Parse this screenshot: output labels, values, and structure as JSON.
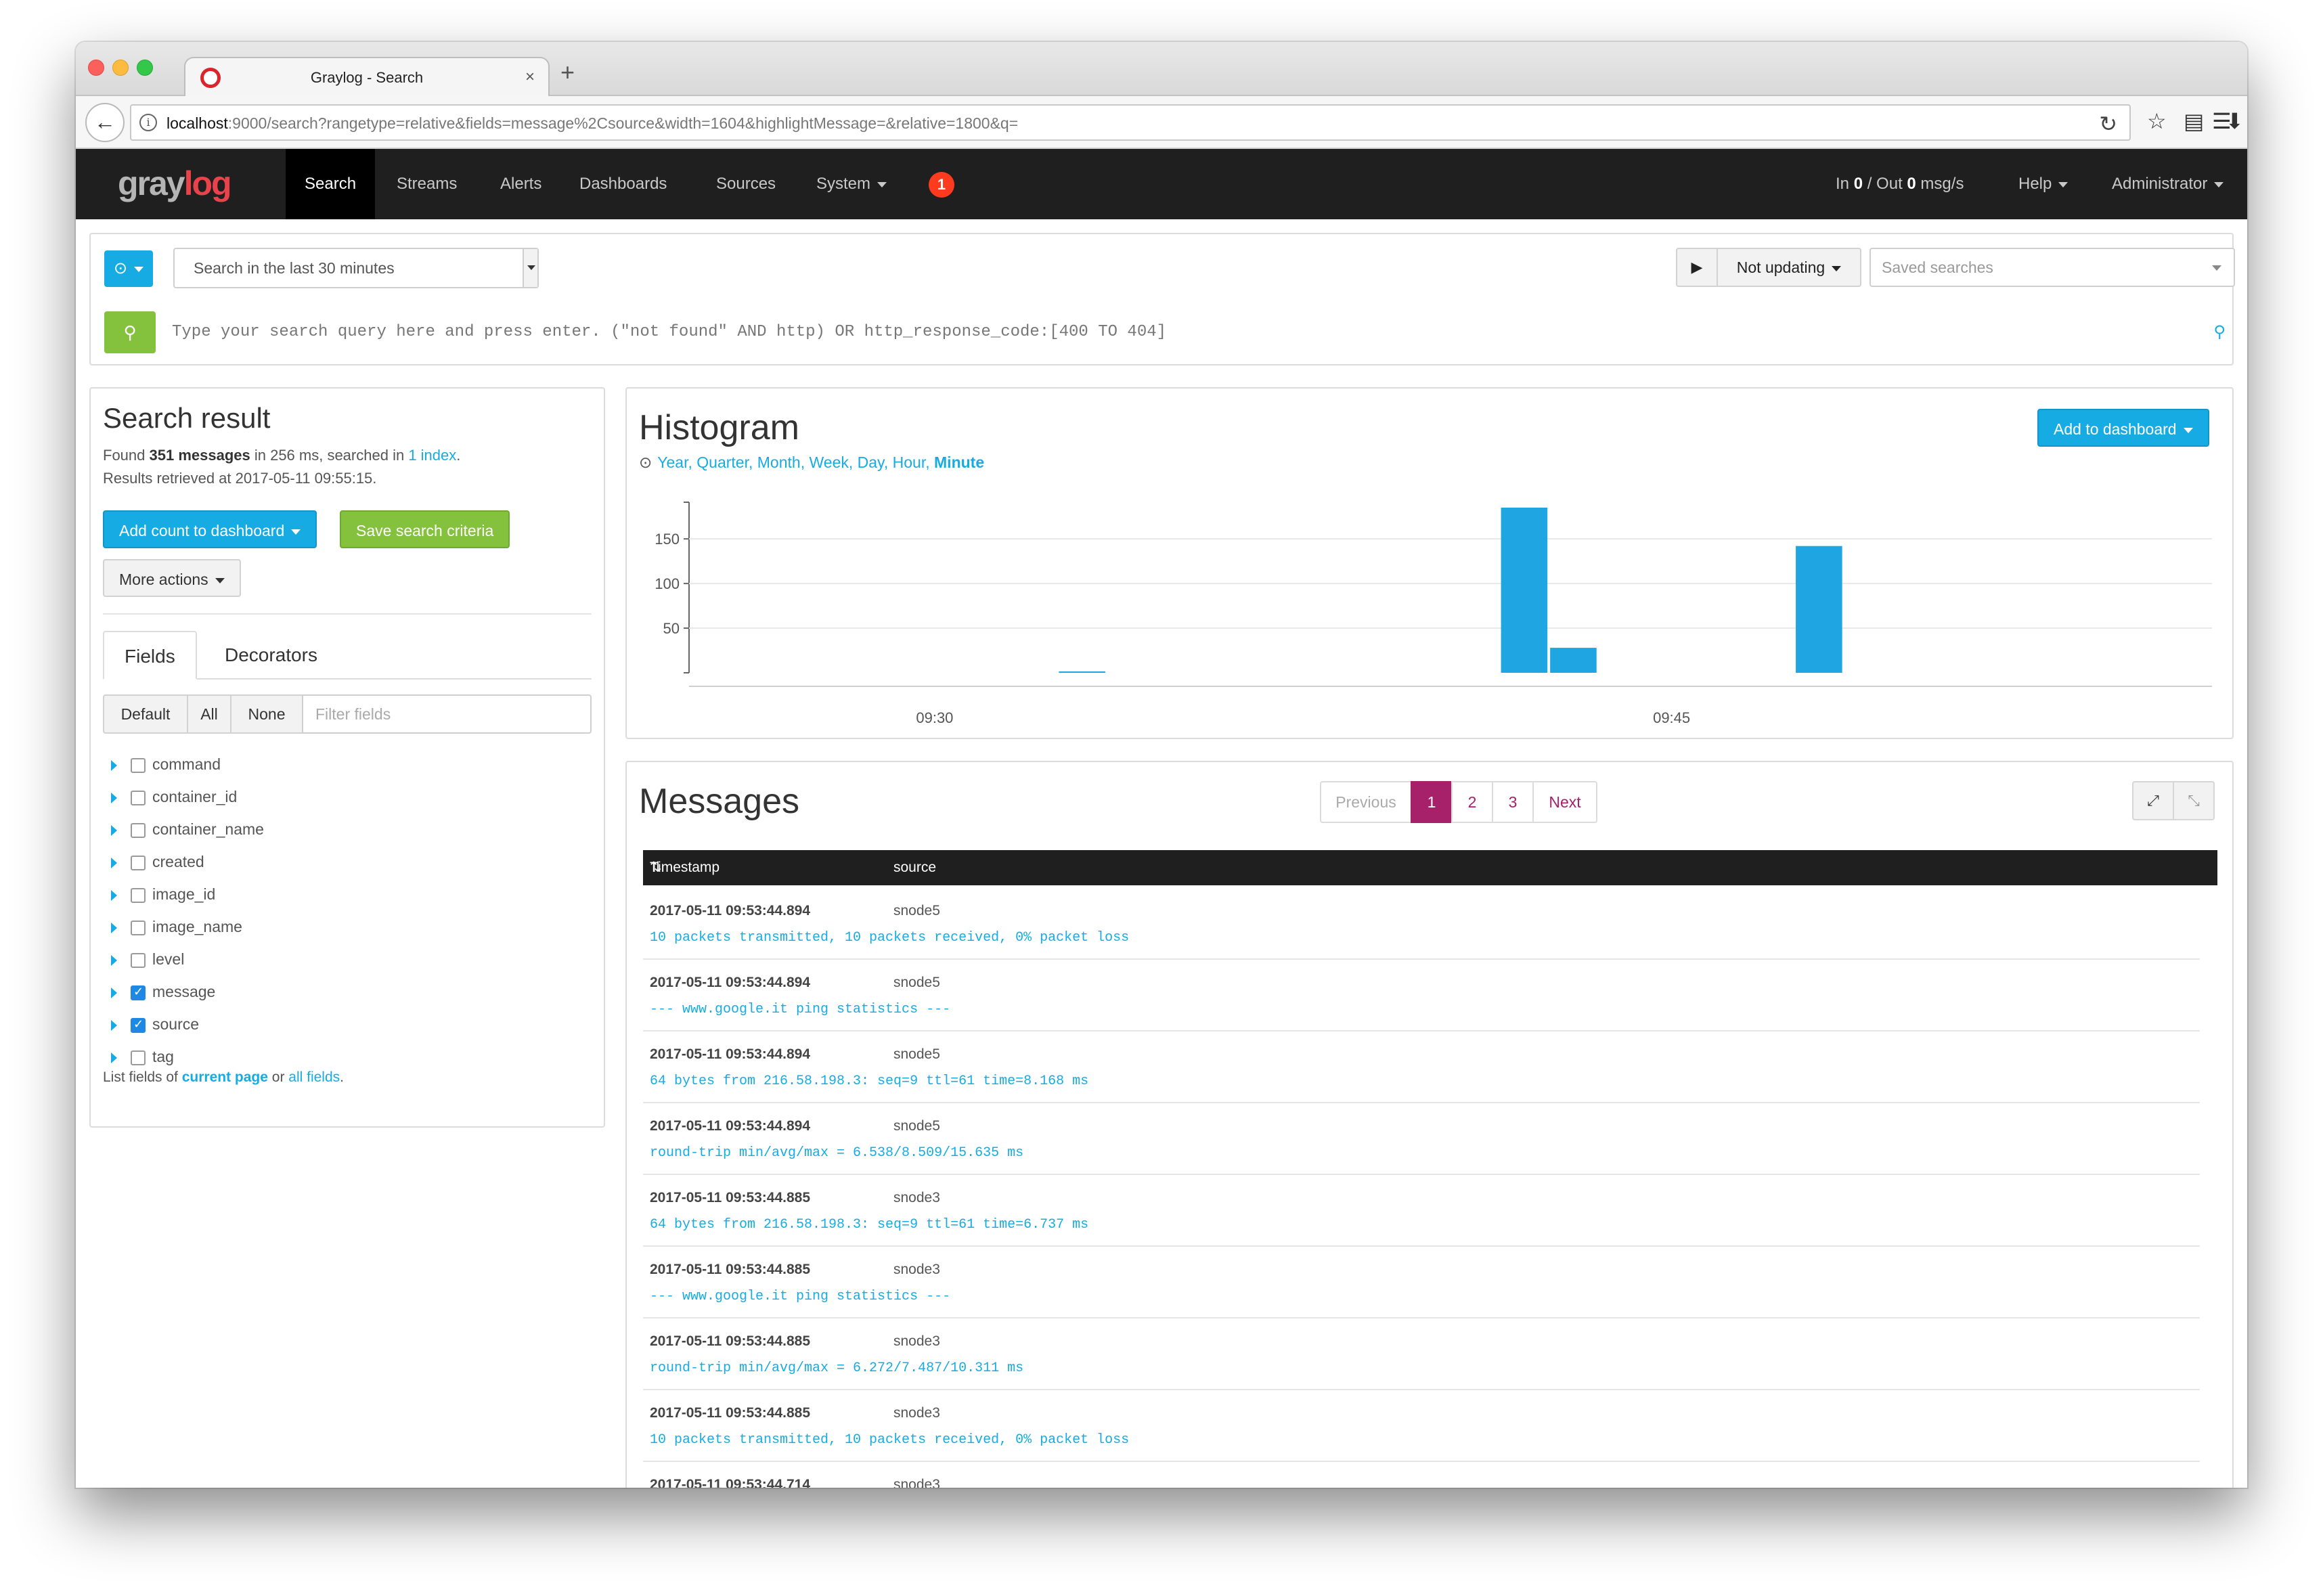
{
  "browser": {
    "tab_title": "Graylog - Search",
    "tab_close": "×",
    "new_tab": "+",
    "back_icon": "←",
    "info_icon": "i",
    "url_host": "localhost",
    "url_rest": ":9000/search?rangetype=relative&fields=message%2Csource&width=1604&highlightMessage=&relative=1800&q=",
    "reload_icon": "↻",
    "star_icon": "☆",
    "reader_icon": "▤",
    "download_icon": "⬇",
    "menu_icon": "☰"
  },
  "navbar": {
    "logo_gray": "gray",
    "logo_red": "log",
    "items": [
      {
        "label": "Search",
        "active": true
      },
      {
        "label": "Streams"
      },
      {
        "label": "Alerts"
      },
      {
        "label": "Dashboards"
      },
      {
        "label": "Sources"
      },
      {
        "label": "System"
      }
    ],
    "notification_count": "1",
    "throughput_in_label": "In ",
    "throughput_in": "0",
    "throughput_out_label": " / Out ",
    "throughput_out": "0",
    "throughput_unit": " msg/s",
    "help": "Help",
    "user": "Administrator"
  },
  "search": {
    "range_icon": "⊙",
    "range_value": "Search in the last 30 minutes",
    "play_icon": "▶",
    "updating_label": "Not updating",
    "saved_searches_placeholder": "Saved searches",
    "go_icon": "🔍",
    "query_placeholder": "Type your search query here and press enter. (\"not found\" AND http) OR http_response_code:[400 TO 404]",
    "bulb_icon": "💡"
  },
  "result": {
    "title": "Search result",
    "found_prefix": "Found ",
    "found_count": "351 messages",
    "found_middle": " in 256 ms, searched in ",
    "index_link": "1 index",
    "found_suffix": ".",
    "retrieved": "Results retrieved at 2017-05-11 09:55:15.",
    "add_count_btn": "Add count to dashboard",
    "save_btn": "Save search criteria",
    "more_actions_btn": "More actions"
  },
  "fields_panel": {
    "tab_fields": "Fields",
    "tab_decorators": "Decorators",
    "filter_default": "Default",
    "filter_all": "All",
    "filter_none": "None",
    "filter_placeholder": "Filter fields",
    "fields": [
      {
        "name": "command",
        "checked": false
      },
      {
        "name": "container_id",
        "checked": false
      },
      {
        "name": "container_name",
        "checked": false
      },
      {
        "name": "created",
        "checked": false
      },
      {
        "name": "image_id",
        "checked": false
      },
      {
        "name": "image_name",
        "checked": false
      },
      {
        "name": "level",
        "checked": false
      },
      {
        "name": "message",
        "checked": true
      },
      {
        "name": "source",
        "checked": true
      },
      {
        "name": "tag",
        "checked": false
      }
    ],
    "footer_prefix": "List fields of ",
    "footer_current": "current page",
    "footer_or": " or ",
    "footer_all": "all fields",
    "footer_suffix": "."
  },
  "histogram": {
    "title": "Histogram",
    "add_btn": "Add to dashboard",
    "clock_icon": "⊙",
    "resolutions": [
      "Year",
      "Quarter",
      "Month",
      "Week",
      "Day",
      "Hour",
      "Minute"
    ],
    "selected_resolution": "Minute",
    "bar_color": "#1fa6e2"
  },
  "chart_data": {
    "type": "bar",
    "x_ticks": [
      "09:30",
      "09:45"
    ],
    "y_ticks": [
      50,
      100,
      150
    ],
    "ylim": [
      0,
      185
    ],
    "xlim": [
      "09:25",
      "09:56"
    ],
    "bars": [
      {
        "x": "09:33",
        "value": 1
      },
      {
        "x": "09:42",
        "value": 185
      },
      {
        "x": "09:43",
        "value": 28
      },
      {
        "x": "09:48",
        "value": 142
      }
    ],
    "grid": true
  },
  "messages": {
    "title": "Messages",
    "pager": {
      "previous": "Previous",
      "pages": [
        "1",
        "2",
        "3"
      ],
      "active": "1",
      "next": "Next"
    },
    "expand_icon": "⤢",
    "collapse_icon": "⤡",
    "col_timestamp": "Timestamp",
    "sort_icon": "⇅",
    "col_source": "source",
    "rows": [
      {
        "ts": "2017-05-11 09:53:44.894",
        "source": "snode5",
        "message": "10 packets transmitted, 10 packets received, 0% packet loss"
      },
      {
        "ts": "2017-05-11 09:53:44.894",
        "source": "snode5",
        "message": "--- www.google.it ping statistics ---"
      },
      {
        "ts": "2017-05-11 09:53:44.894",
        "source": "snode5",
        "message": "64 bytes from 216.58.198.3: seq=9 ttl=61 time=8.168 ms"
      },
      {
        "ts": "2017-05-11 09:53:44.894",
        "source": "snode5",
        "message": "round-trip min/avg/max = 6.538/8.509/15.635 ms"
      },
      {
        "ts": "2017-05-11 09:53:44.885",
        "source": "snode3",
        "message": "64 bytes from 216.58.198.3: seq=9 ttl=61 time=6.737 ms"
      },
      {
        "ts": "2017-05-11 09:53:44.885",
        "source": "snode3",
        "message": "--- www.google.it ping statistics ---"
      },
      {
        "ts": "2017-05-11 09:53:44.885",
        "source": "snode3",
        "message": "round-trip min/avg/max = 6.272/7.487/10.311 ms"
      },
      {
        "ts": "2017-05-11 09:53:44.885",
        "source": "snode3",
        "message": "10 packets transmitted, 10 packets received, 0% packet loss"
      },
      {
        "ts": "2017-05-11 09:53:44.714",
        "source": "snode3",
        "message": ""
      }
    ]
  }
}
